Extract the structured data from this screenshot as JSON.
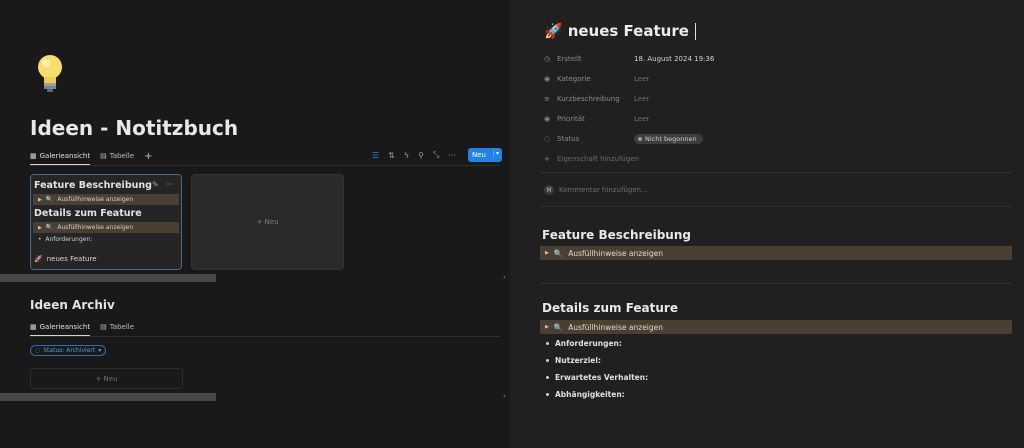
{
  "left": {
    "page_title": "Ideen - Notitzbuch",
    "views": [
      {
        "label": "Galerieansicht",
        "icon": "grid-icon",
        "active": true
      },
      {
        "label": "Tabelle",
        "icon": "table-icon",
        "active": false
      }
    ],
    "new_button": "Neu",
    "card": {
      "heading1": "Feature Beschreibung",
      "callout1": "Ausfüllhinweise anzeigen",
      "heading2": "Details zum Feature",
      "callout2": "Ausfüllhinweise anzeigen",
      "bullet": "Anforderungen:",
      "footer": "neues Feature"
    },
    "new_card_label": "+ Neu",
    "archiv": {
      "title": "Ideen Archiv",
      "views": [
        {
          "label": "Galerieansicht",
          "active": true
        },
        {
          "label": "Tabelle",
          "active": false
        }
      ],
      "filter_chip": "Status: Archiviert",
      "new_row": "+ Neu"
    }
  },
  "right": {
    "title": "neues Feature",
    "properties": [
      {
        "label": "Erstellt",
        "icon": "clock-icon",
        "value": "18. August 2024 19:36",
        "empty": false
      },
      {
        "label": "Kategorie",
        "icon": "select-icon",
        "value": "Leer",
        "empty": true
      },
      {
        "label": "Kurzbeschreibung",
        "icon": "text-lines-icon",
        "value": "Leer",
        "empty": true
      },
      {
        "label": "Priorität",
        "icon": "select-icon",
        "value": "Leer",
        "empty": true
      },
      {
        "label": "Status",
        "icon": "status-icon",
        "value": "Nicht begonnen",
        "empty": false
      }
    ],
    "add_property": "Eigenschaft hinzufügen",
    "comment_avatar": "M",
    "comment_placeholder": "Kommentar hinzufügen...",
    "section1": {
      "heading": "Feature Beschreibung",
      "callout": "Ausfüllhinweise anzeigen"
    },
    "section2": {
      "heading": "Details zum Feature",
      "callout": "Ausfüllhinweise anzeigen",
      "bullets": [
        "Anforderungen:",
        "Nutzerziel:",
        "Erwartetes Verhalten:",
        "Abhängigkeiten:"
      ]
    }
  }
}
